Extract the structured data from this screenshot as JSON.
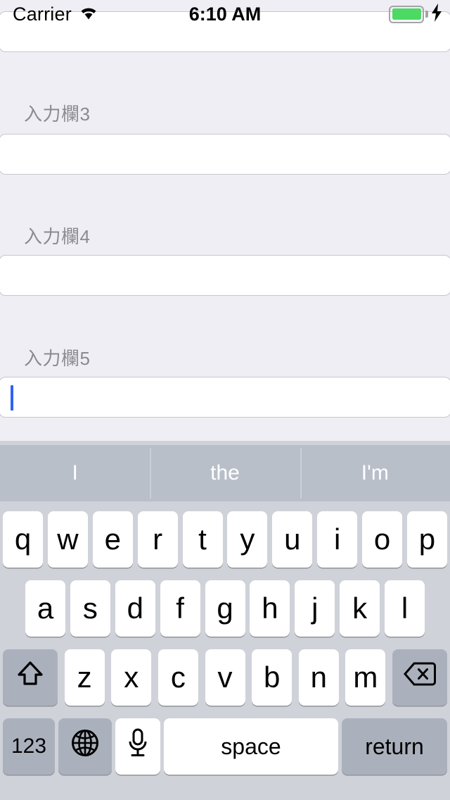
{
  "status_bar": {
    "carrier": "Carrier",
    "wifi_icon": "wifi-icon",
    "time": "6:10 AM",
    "battery_icon": "battery-icon",
    "battery_level_percent": 100,
    "charging_icon": "lightning-bolt-icon",
    "battery_color": "#4CD964"
  },
  "form": {
    "fields": [
      {
        "label": "",
        "value": "",
        "placeholder": "",
        "focused": false
      },
      {
        "label": "入力欄3",
        "value": "",
        "placeholder": "",
        "focused": false
      },
      {
        "label": "入力欄4",
        "value": "",
        "placeholder": "",
        "focused": false
      },
      {
        "label": "入力欄5",
        "value": "",
        "placeholder": "",
        "focused": true
      }
    ],
    "label_color": "#8A8A8F",
    "background_color": "#EFEEF4",
    "caret_color": "#2F63F2"
  },
  "keyboard": {
    "background_color": "#CFD2D9",
    "predictions": [
      "I",
      "the",
      "I'm"
    ],
    "prediction_bar_color": "#B9BFC9",
    "row1": [
      "q",
      "w",
      "e",
      "r",
      "t",
      "y",
      "u",
      "i",
      "o",
      "p"
    ],
    "row2": [
      "a",
      "s",
      "d",
      "f",
      "g",
      "h",
      "j",
      "k",
      "l"
    ],
    "row3_letters": [
      "z",
      "x",
      "c",
      "v",
      "b",
      "n",
      "m"
    ],
    "shift_key": {
      "name": "shift-icon",
      "label": ""
    },
    "delete_key": {
      "name": "delete-icon",
      "label": ""
    },
    "numeric_key_label": "123",
    "globe_key": {
      "name": "globe-icon",
      "label": ""
    },
    "mic_key": {
      "name": "microphone-icon",
      "label": ""
    },
    "space_key_label": "space",
    "return_key_label": "return"
  }
}
